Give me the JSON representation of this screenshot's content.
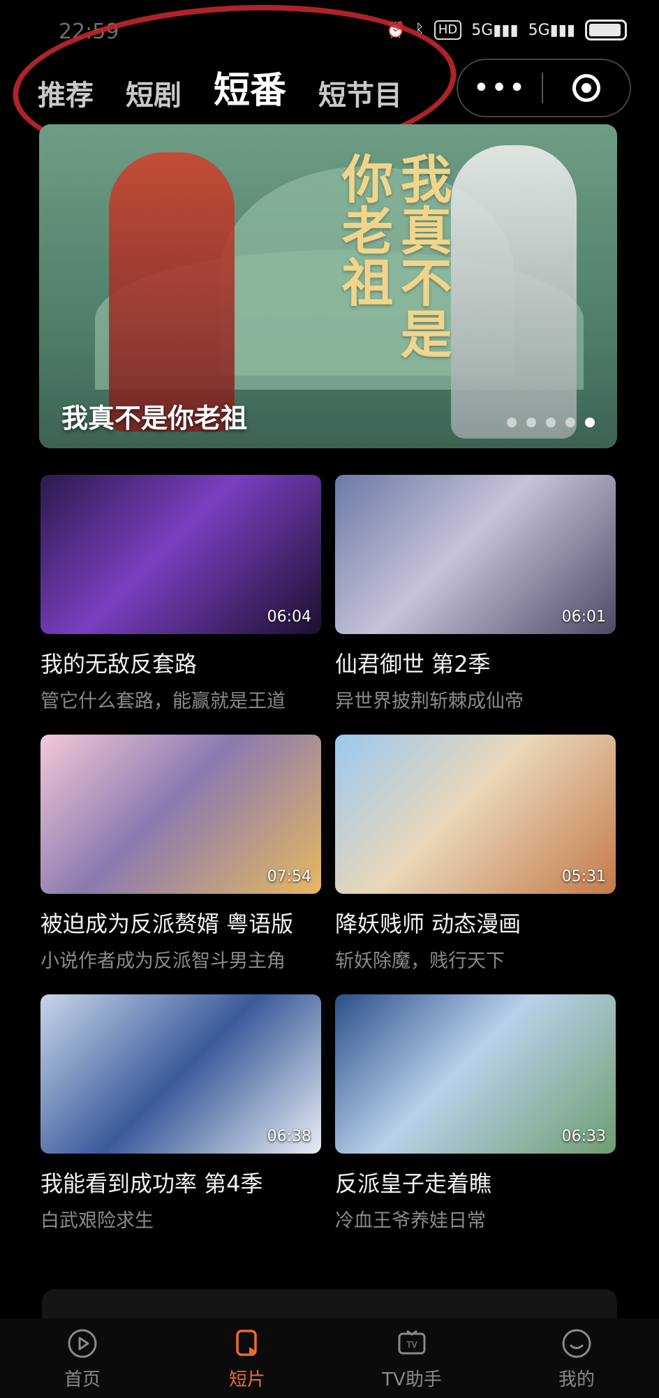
{
  "status_bar": {
    "time": "22:59",
    "hd_label": "HD",
    "net1": "5G",
    "net2": "5G"
  },
  "tabs": [
    {
      "label": "推荐",
      "active": false
    },
    {
      "label": "短剧",
      "active": false
    },
    {
      "label": "短番",
      "active": true
    },
    {
      "label": "短节目",
      "active": false
    }
  ],
  "capsule": {
    "more_icon": "more-dots-icon",
    "target_icon": "target-icon"
  },
  "banner": {
    "title": "我真不是你老祖",
    "calligraphy": "我真不是你老祖",
    "slide_index": 5,
    "slide_count": 5
  },
  "cards": [
    {
      "duration": "06:04",
      "title": "我的无敌反套路",
      "subtitle": "管它什么套路，能赢就是王道"
    },
    {
      "duration": "06:01",
      "title": "仙君御世 第2季",
      "subtitle": "异世界披荆斩棘成仙帝"
    },
    {
      "duration": "07:54",
      "title": "被迫成为反派赘婿 粤语版",
      "subtitle": "小说作者成为反派智斗男主角"
    },
    {
      "duration": "05:31",
      "title": "降妖贱师 动态漫画",
      "subtitle": "斩妖除魔，贱行天下"
    },
    {
      "duration": "06:38",
      "title": "我能看到成功率 第4季",
      "subtitle": "白武艰险求生"
    },
    {
      "duration": "06:33",
      "title": "反派皇子走着瞧",
      "subtitle": "冷血王爷养娃日常"
    }
  ],
  "bottom_nav": [
    {
      "label": "首页",
      "icon": "play-icon",
      "active": false
    },
    {
      "label": "短片",
      "icon": "short-video-icon",
      "active": true
    },
    {
      "label": "TV助手",
      "icon": "tv-icon",
      "active": false
    },
    {
      "label": "我的",
      "icon": "smile-icon",
      "active": false
    }
  ],
  "colors": {
    "accent": "#f06a2a",
    "annotation": "#c0272d",
    "background": "#000000"
  }
}
